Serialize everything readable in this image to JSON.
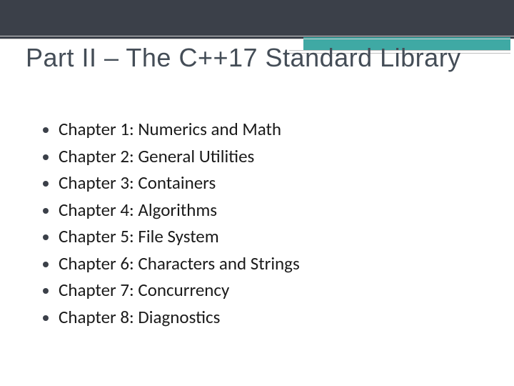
{
  "title": "Part II – The C++17 Standard Library",
  "chapters": [
    "Chapter 1: Numerics and Math",
    "Chapter 2: General Utilities",
    "Chapter 3: Containers",
    "Chapter 4: Algorithms",
    "Chapter 5: File System",
    "Chapter 6: Characters and Strings",
    "Chapter 7: Concurrency",
    "Chapter 8: Diagnostics"
  ]
}
